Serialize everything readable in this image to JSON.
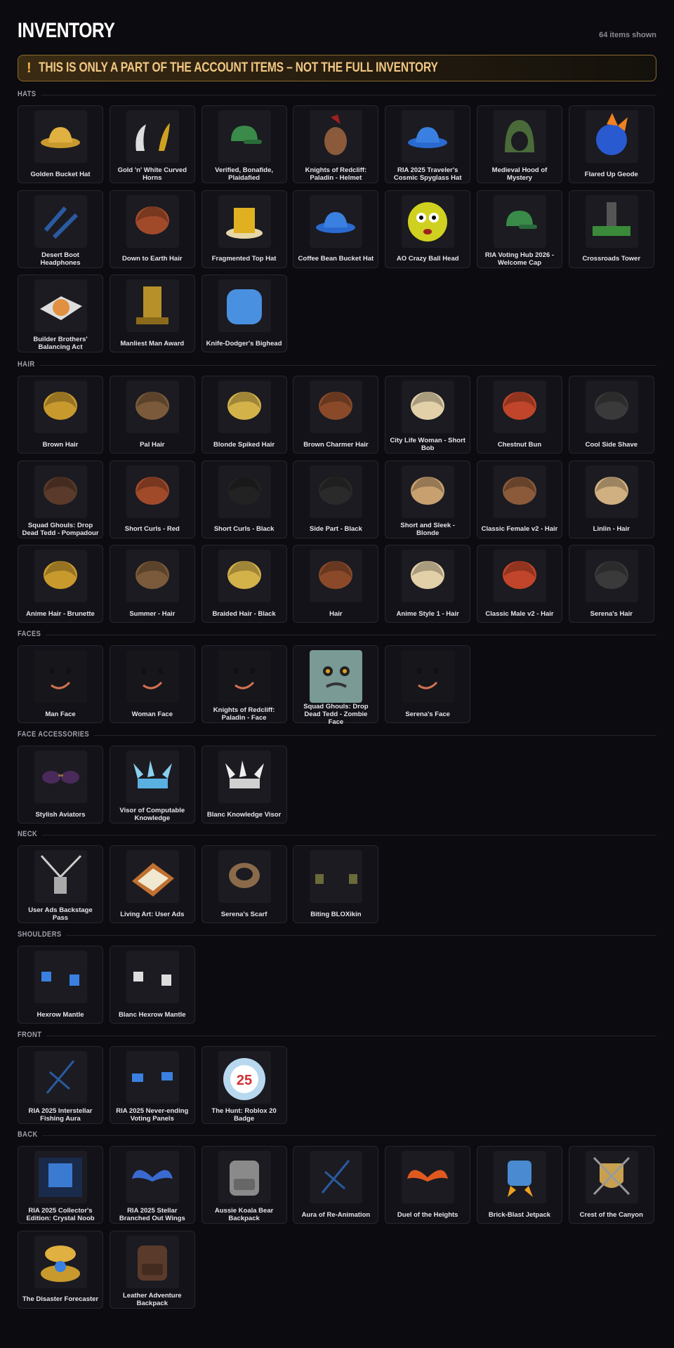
{
  "header": {
    "title": "INVENTORY",
    "count": "64 items shown"
  },
  "banner": {
    "icon": "!",
    "text": "THIS IS ONLY A PART OF THE ACCOUNT ITEMS – NOT THE FULL INVENTORY"
  },
  "colors": {
    "background": "#0b0b10",
    "card": "#121218",
    "banner_accent": "#f2b54a"
  },
  "sections": [
    {
      "label": "HATS",
      "items": [
        {
          "name": "Golden Bucket Hat",
          "icon": "hat-icon"
        },
        {
          "name": "Gold 'n' White Curved Horns",
          "icon": "horns-icon"
        },
        {
          "name": "Verified, Bonafide, Plaidafied",
          "icon": "cap-icon"
        },
        {
          "name": "Knights of Redcliff: Paladin - Helmet",
          "icon": "helmet-icon"
        },
        {
          "name": "RIA 2025 Traveler's Cosmic Spyglass Hat",
          "icon": "hat-icon"
        },
        {
          "name": "Medieval Hood of Mystery",
          "icon": "hood-icon"
        },
        {
          "name": "Flared Up Geode",
          "icon": "geode-icon"
        },
        {
          "name": "Desert Boot Headphones",
          "icon": "headphones-icon"
        },
        {
          "name": "Down to Earth Hair",
          "icon": "hair-icon"
        },
        {
          "name": "Fragmented Top Hat",
          "icon": "tophat-icon"
        },
        {
          "name": "Coffee Bean Bucket Hat",
          "icon": "hat-icon"
        },
        {
          "name": "AO Crazy Ball Head",
          "icon": "ballhead-icon"
        },
        {
          "name": "RIA Voting Hub 2026 - Welcome Cap",
          "icon": "cap-icon"
        },
        {
          "name": "Crossroads Tower",
          "icon": "tower-icon"
        },
        {
          "name": "Builder Brothers' Balancing Act",
          "icon": "pizza-icon"
        },
        {
          "name": "Manliest Man Award",
          "icon": "trophy-icon"
        },
        {
          "name": "Knife-Dodger's Bighead",
          "icon": "bighead-icon"
        }
      ]
    },
    {
      "label": "HAIR",
      "items": [
        {
          "name": "Brown Hair",
          "icon": "hair-icon"
        },
        {
          "name": "Pal Hair",
          "icon": "hair-icon"
        },
        {
          "name": "Blonde Spiked Hair",
          "icon": "hair-icon"
        },
        {
          "name": "Brown Charmer Hair",
          "icon": "hair-icon"
        },
        {
          "name": "City Life Woman - Short Bob",
          "icon": "hair-icon"
        },
        {
          "name": "Chestnut Bun",
          "icon": "hair-icon"
        },
        {
          "name": "Cool Side Shave",
          "icon": "hair-icon"
        },
        {
          "name": "Squad Ghouls: Drop Dead Tedd - Pompadour",
          "icon": "hair-icon"
        },
        {
          "name": "Short Curls - Red",
          "icon": "hair-icon"
        },
        {
          "name": "Short Curls - Black",
          "icon": "hair-icon"
        },
        {
          "name": "Side Part - Black",
          "icon": "hair-icon"
        },
        {
          "name": "Short and Sleek - Blonde",
          "icon": "hair-icon"
        },
        {
          "name": "Classic Female v2 - Hair",
          "icon": "hair-icon"
        },
        {
          "name": "Linlin - Hair",
          "icon": "hair-icon"
        },
        {
          "name": "Anime Hair - Brunette",
          "icon": "hair-icon"
        },
        {
          "name": "Summer - Hair",
          "icon": "hair-icon"
        },
        {
          "name": "Braided Hair - Black",
          "icon": "hair-icon"
        },
        {
          "name": "Hair",
          "icon": "hair-icon"
        },
        {
          "name": "Anime Style 1 - Hair",
          "icon": "hair-icon"
        },
        {
          "name": "Classic Male v2 - Hair",
          "icon": "hair-icon"
        },
        {
          "name": "Serena's Hair",
          "icon": "hair-icon"
        }
      ]
    },
    {
      "label": "FACES",
      "items": [
        {
          "name": "Man Face",
          "icon": "face-icon"
        },
        {
          "name": "Woman Face",
          "icon": "face-icon"
        },
        {
          "name": "Knights of Redcliff: Paladin - Face",
          "icon": "face-icon"
        },
        {
          "name": "Squad Ghouls: Drop Dead Tedd - Zombie Face",
          "icon": "zombie-face-icon"
        },
        {
          "name": "Serena's Face",
          "icon": "face-icon"
        }
      ]
    },
    {
      "label": "FACE ACCESSORIES",
      "items": [
        {
          "name": "Stylish Aviators",
          "icon": "sunglasses-icon"
        },
        {
          "name": "Visor of Computable Knowledge",
          "icon": "visor-icon"
        },
        {
          "name": "Blanc Knowledge Visor",
          "icon": "visor-icon"
        }
      ]
    },
    {
      "label": "NECK",
      "items": [
        {
          "name": "User Ads Backstage Pass",
          "icon": "lanyard-icon"
        },
        {
          "name": "Living Art: User Ads",
          "icon": "painting-icon"
        },
        {
          "name": "Serena's Scarf",
          "icon": "scarf-icon"
        },
        {
          "name": "Biting BLOXikin",
          "icon": "figures-icon"
        }
      ]
    },
    {
      "label": "SHOULDERS",
      "items": [
        {
          "name": "Hexrow Mantle",
          "icon": "mantle-icon"
        },
        {
          "name": "Blanc Hexrow Mantle",
          "icon": "mantle-icon"
        }
      ]
    },
    {
      "label": "FRONT",
      "items": [
        {
          "name": "RIA 2025 Interstellar Fishing Aura",
          "icon": "aura-icon"
        },
        {
          "name": "RIA 2025 Never-ending Voting Panels",
          "icon": "panels-icon"
        },
        {
          "name": "The Hunt: Roblox 20 Badge",
          "icon": "badge-icon",
          "badge_text": "25"
        }
      ]
    },
    {
      "label": "BACK",
      "items": [
        {
          "name": "RIA 2025 Collector's Edition: Crystal Noob",
          "icon": "box-icon"
        },
        {
          "name": "RIA 2025 Stellar Branched Out Wings",
          "icon": "wings-icon"
        },
        {
          "name": "Aussie Koala Bear Backpack",
          "icon": "backpack-icon"
        },
        {
          "name": "Aura of Re-Animation",
          "icon": "aura-icon"
        },
        {
          "name": "Duel of the Heights",
          "icon": "wings-icon"
        },
        {
          "name": "Brick-Blast Jetpack",
          "icon": "jetpack-icon"
        },
        {
          "name": "Crest of the Canyon",
          "icon": "crest-icon"
        },
        {
          "name": "The Disaster Forecaster",
          "icon": "forecaster-icon"
        },
        {
          "name": "Leather Adventure Backpack",
          "icon": "backpack-icon"
        }
      ]
    }
  ]
}
